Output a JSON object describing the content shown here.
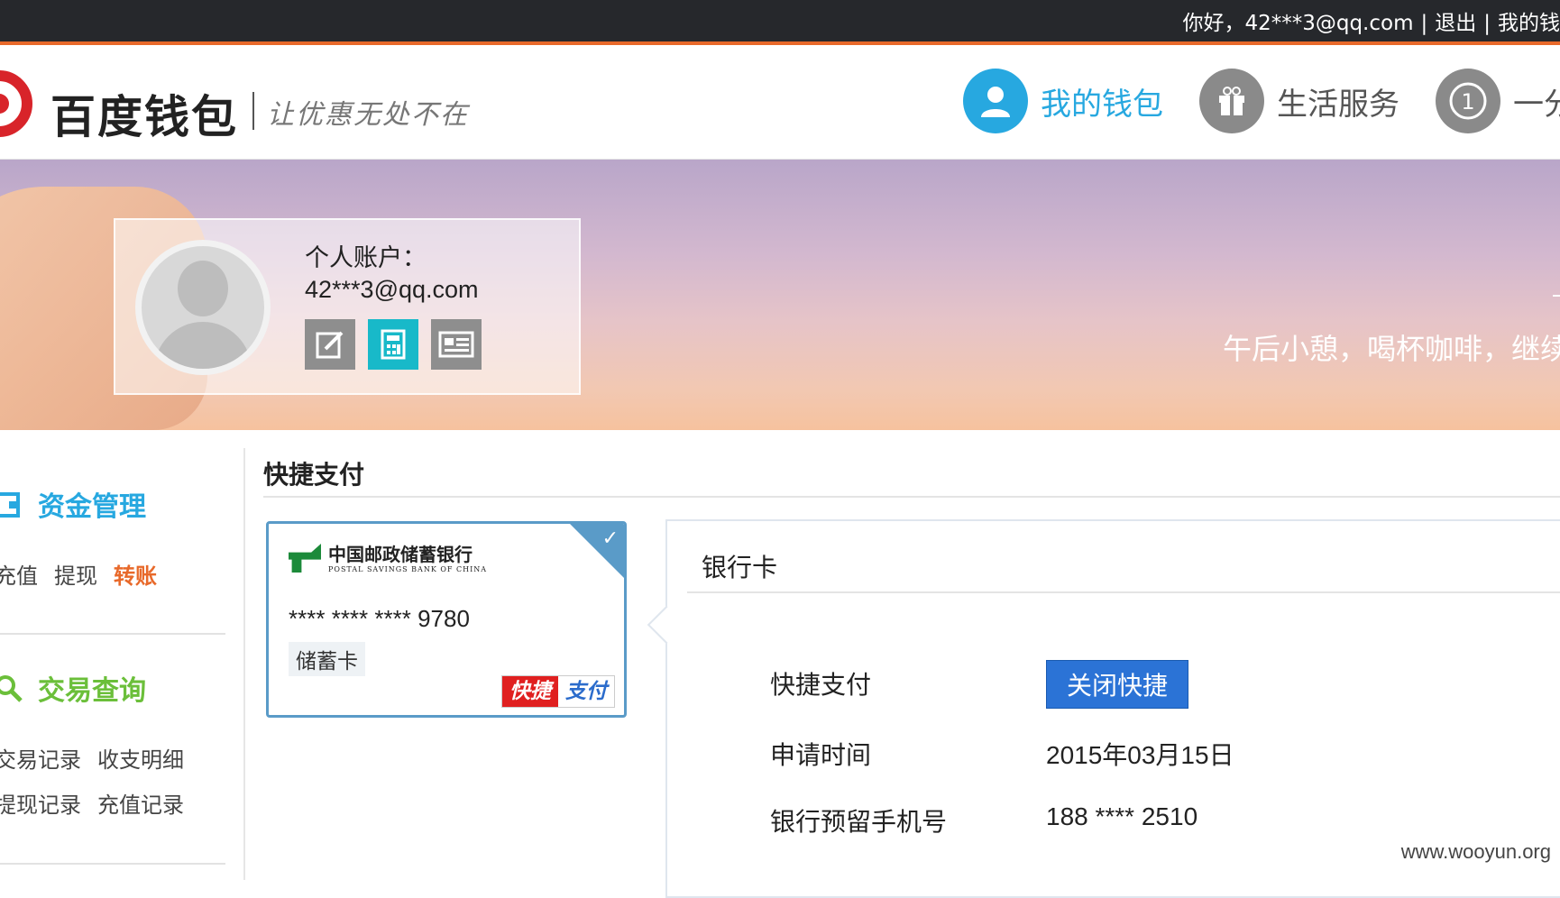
{
  "topbar": {
    "greeting": "你好，42***3@qq.com",
    "logout": "退出",
    "my_wallet": "我的钱"
  },
  "header": {
    "logo": "百度钱包",
    "slogan": "让优惠无处不在",
    "nav": [
      {
        "label": "我的钱包",
        "icon": "user-icon",
        "color": "#27a8e0"
      },
      {
        "label": "生活服务",
        "icon": "gift-icon",
        "color": "#8a8a8a"
      },
      {
        "label": "一分",
        "icon": "one-coin-icon",
        "color": "#8a8a8a"
      }
    ]
  },
  "banner": {
    "account_label": "个人账户：",
    "account_email": "42***3@qq.com",
    "actions": [
      {
        "icon": "edit-icon",
        "color": "#8e8e8e"
      },
      {
        "icon": "calculator-icon",
        "color": "#18b9c9"
      },
      {
        "icon": "id-card-icon",
        "color": "#8e8e8e"
      }
    ],
    "slogan": "午后小憩，喝杯咖啡，继续"
  },
  "sidebar": {
    "fund": {
      "title": "资金管理",
      "color": "#27a8e0",
      "links": [
        "充值",
        "提现",
        "转账"
      ],
      "active": "转账",
      "active_color": "#e8692a"
    },
    "query": {
      "title": "交易查询",
      "color": "#6bbf3a",
      "links_row1": [
        "交易记录",
        "收支明细"
      ],
      "links_row2": [
        "提现记录",
        "充值记录"
      ]
    }
  },
  "main": {
    "title": "快捷支付",
    "card": {
      "bank_name": "中国邮政储蓄银行",
      "bank_en": "POSTAL SAVINGS BANK OF CHINA",
      "number": "**** **** **** 9780",
      "type": "储蓄卡",
      "badge_a": "快捷",
      "badge_b": "支付"
    },
    "detail": {
      "title": "银行卡",
      "quickpay_label": "快捷支付",
      "close_button": "关闭快捷",
      "apply_label": "申请时间",
      "apply_value": "2015年03月15日",
      "phone_label": "银行预留手机号",
      "phone_value": "188 **** 2510"
    }
  },
  "watermark": "www.wooyun.org"
}
